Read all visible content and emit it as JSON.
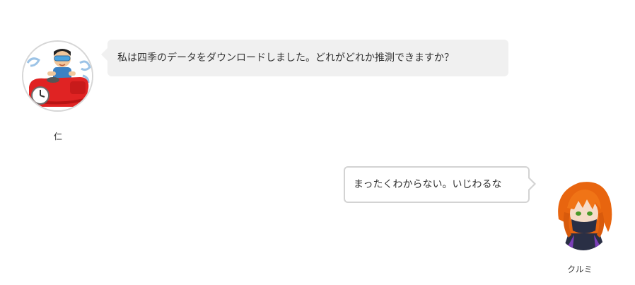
{
  "messages": [
    {
      "side": "left",
      "author": "仁",
      "avatar_icon": "driver-in-red-bumper-car-icon",
      "text": "私は四季のデータをダウンロードしました。どれがどれか推測できますか？"
    },
    {
      "side": "right",
      "author": "クルミ",
      "avatar_icon": "orange-haired-masked-character-icon",
      "text": "まったくわからない。いじわるな"
    }
  ],
  "colors": {
    "left_bubble_bg": "#f0f0f0",
    "right_bubble_border": "#d3d3d3",
    "text": "#333333"
  }
}
